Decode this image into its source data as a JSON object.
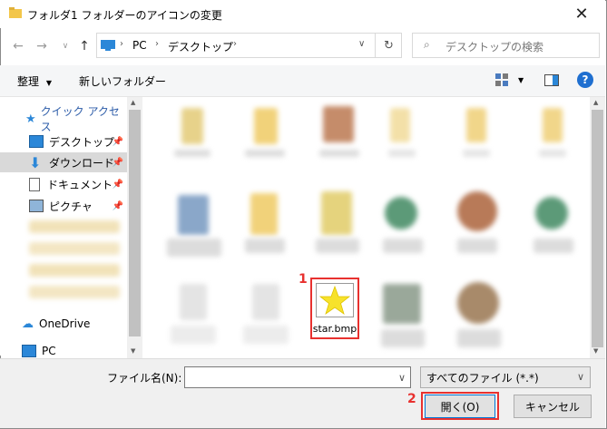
{
  "window": {
    "title": "フォルダ1 フォルダーのアイコンの変更",
    "close": "✕"
  },
  "nav": {
    "breadcrumb": [
      "PC",
      "デスクトップ"
    ],
    "search_placeholder": "デスクトップの検索"
  },
  "toolbar": {
    "organize": "整理",
    "new_folder": "新しいフォルダー"
  },
  "sidebar": {
    "quick_access": "クイック アクセス",
    "items": [
      "デスクトップ",
      "ダウンロード",
      "ドキュメント",
      "ピクチャ"
    ],
    "onedrive": "OneDrive",
    "pc": "PC"
  },
  "file": {
    "name": "star.bmp"
  },
  "markers": {
    "m1": "1",
    "m2": "2"
  },
  "bottom": {
    "filename_label": "ファイル名(N):",
    "filename_value": "",
    "filetype": "すべてのファイル (*.*)",
    "open": "開く(O)",
    "cancel": "キャンセル"
  },
  "colors": {
    "accent": "#e8312f",
    "folder": "#f3c64a",
    "star": "#f7e22b"
  }
}
